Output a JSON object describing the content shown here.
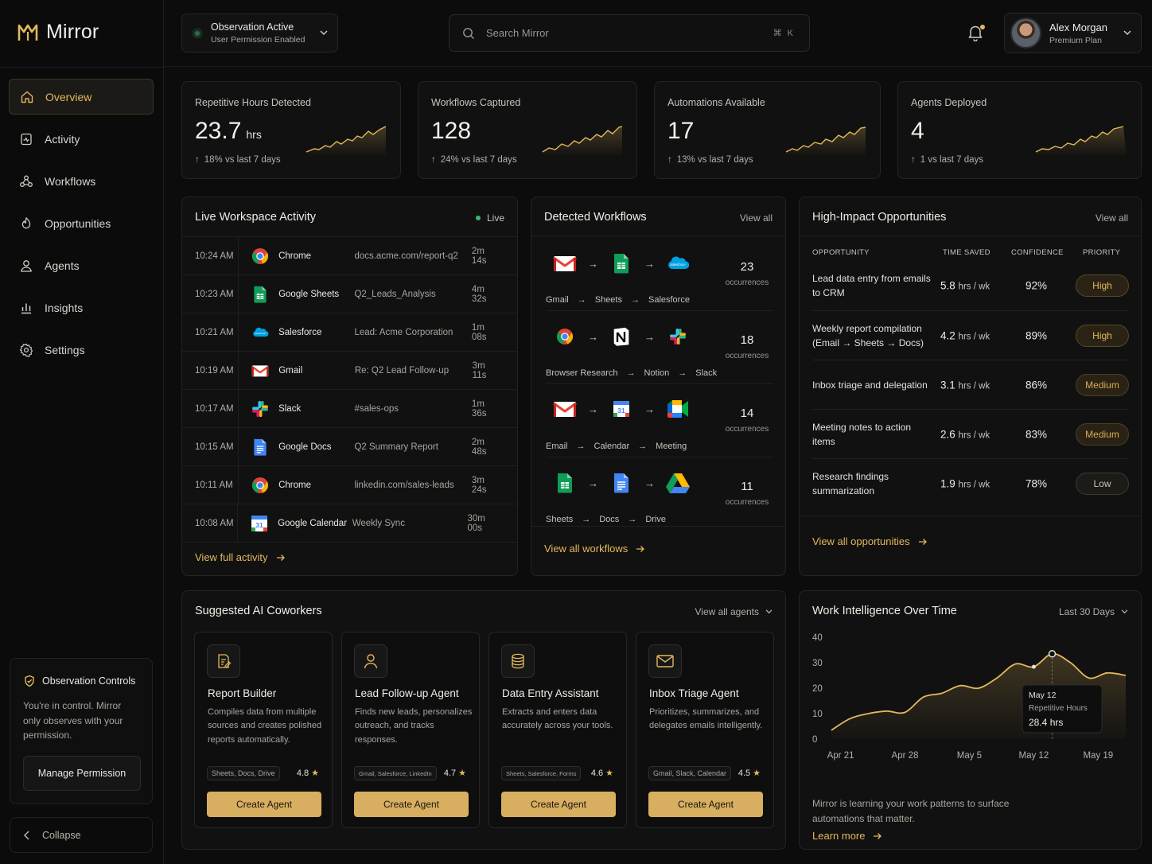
{
  "app": {
    "name": "Mirror"
  },
  "sidebar": {
    "items": [
      {
        "label": "Overview",
        "icon": "home-icon",
        "active": true
      },
      {
        "label": "Activity",
        "icon": "activity-icon",
        "active": false
      },
      {
        "label": "Workflows",
        "icon": "workflows-icon",
        "active": false
      },
      {
        "label": "Opportunities",
        "icon": "opportunities-icon",
        "active": false
      },
      {
        "label": "Agents",
        "icon": "agents-icon",
        "active": false
      },
      {
        "label": "Insights",
        "icon": "insights-icon",
        "active": false
      },
      {
        "label": "Settings",
        "icon": "settings-icon",
        "active": false
      }
    ],
    "observation": {
      "title": "Observation Controls",
      "text": "You're in control. Mirror only observes with your permission.",
      "button": "Manage Permission"
    },
    "collapse_label": "Collapse"
  },
  "topbar": {
    "status_title": "Observation Active",
    "status_subtitle": "User Permission Enabled",
    "search_placeholder": "Search Mirror",
    "search_shortcut": "⌘ K",
    "user_name": "Alex Morgan",
    "user_plan": "Premium Plan"
  },
  "stats": [
    {
      "label": "Repetitive Hours Detected",
      "value": "23.7",
      "unit": "hrs",
      "delta": "18% vs last 7 days"
    },
    {
      "label": "Workflows Captured",
      "value": "128",
      "unit": "",
      "delta": "24% vs last 7 days"
    },
    {
      "label": "Automations Available",
      "value": "17",
      "unit": "",
      "delta": "13% vs last 7 days"
    },
    {
      "label": "Agents Deployed",
      "value": "4",
      "unit": "",
      "delta": "1 vs last 7 days"
    }
  ],
  "activity": {
    "title": "Live Workspace Activity",
    "live_label": "Live",
    "rows": [
      {
        "time": "10:24 AM",
        "app": "Chrome",
        "detail": "docs.acme.com/report-q2",
        "duration": "2m 14s",
        "icon": "chrome-icon"
      },
      {
        "time": "10:23 AM",
        "app": "Google Sheets",
        "detail": "Q2_Leads_Analysis",
        "duration": "4m 32s",
        "icon": "sheets-icon"
      },
      {
        "time": "10:21 AM",
        "app": "Salesforce",
        "detail": "Lead: Acme Corporation",
        "duration": "1m 08s",
        "icon": "salesforce-icon"
      },
      {
        "time": "10:19 AM",
        "app": "Gmail",
        "detail": "Re: Q2 Lead Follow-up",
        "duration": "3m 11s",
        "icon": "gmail-icon"
      },
      {
        "time": "10:17 AM",
        "app": "Slack",
        "detail": "#sales-ops",
        "duration": "1m 36s",
        "icon": "slack-icon"
      },
      {
        "time": "10:15 AM",
        "app": "Google Docs",
        "detail": "Q2 Summary Report",
        "duration": "2m 48s",
        "icon": "docs-icon"
      },
      {
        "time": "10:11 AM",
        "app": "Chrome",
        "detail": "linkedin.com/sales-leads",
        "duration": "3m 24s",
        "icon": "chrome-icon"
      },
      {
        "time": "10:08 AM",
        "app": "Google Calendar",
        "detail": "Weekly Sync",
        "duration": "30m 00s",
        "icon": "calendar-icon"
      }
    ],
    "footer_link": "View full activity"
  },
  "workflows": {
    "title": "Detected Workflows",
    "view_all": "View all",
    "rows": [
      {
        "apps": [
          "Gmail",
          "Sheets",
          "Salesforce"
        ],
        "icons": [
          "gmail-icon",
          "sheets-icon",
          "salesforce-icon"
        ],
        "count": "23",
        "unit": "occurrences"
      },
      {
        "apps": [
          "Browser Research",
          "Notion",
          "Slack"
        ],
        "icons": [
          "chrome-icon",
          "notion-icon",
          "slack-icon"
        ],
        "count": "18",
        "unit": "occurrences"
      },
      {
        "apps": [
          "Email",
          "Calendar",
          "Meeting"
        ],
        "icons": [
          "gmail-icon",
          "calendar-icon",
          "meet-icon"
        ],
        "count": "14",
        "unit": "occurrences"
      },
      {
        "apps": [
          "Sheets",
          "Docs",
          "Drive"
        ],
        "icons": [
          "sheets-icon",
          "docs-icon",
          "drive-icon"
        ],
        "count": "11",
        "unit": "occurrences"
      }
    ],
    "footer_link": "View all workflows"
  },
  "opportunities": {
    "title": "High-Impact Opportunities",
    "view_all": "View all",
    "headers": {
      "opportunity": "OPPORTUNITY",
      "time_saved": "TIME SAVED",
      "confidence": "CONFIDENCE",
      "priority": "PRIORITY"
    },
    "rows": [
      {
        "name": "Lead data entry from emails to CRM",
        "hours": "5.8",
        "unit": "hrs / wk",
        "confidence": "92%",
        "priority": "High",
        "level": "high"
      },
      {
        "name": "Weekly report compilation (Email → Sheets → Docs)",
        "hours": "4.2",
        "unit": "hrs / wk",
        "confidence": "89%",
        "priority": "High",
        "level": "high"
      },
      {
        "name": "Inbox triage and delegation",
        "hours": "3.1",
        "unit": "hrs / wk",
        "confidence": "86%",
        "priority": "Medium",
        "level": "medium"
      },
      {
        "name": "Meeting notes to action items",
        "hours": "2.6",
        "unit": "hrs / wk",
        "confidence": "83%",
        "priority": "Medium",
        "level": "medium"
      },
      {
        "name": "Research findings summarization",
        "hours": "1.9",
        "unit": "hrs / wk",
        "confidence": "78%",
        "priority": "Low",
        "level": "low"
      }
    ],
    "footer_link": "View all opportunities"
  },
  "agents": {
    "title": "Suggested AI Coworkers",
    "view_all": "View all agents",
    "cards": [
      {
        "name": "Report Builder",
        "desc": "Compiles data from multiple sources and creates polished reports automatically.",
        "tags": "Sheets, Docs, Drive",
        "rating": "4.8",
        "button": "Create Agent",
        "icon": "report-icon"
      },
      {
        "name": "Lead Follow-up Agent",
        "desc": "Finds new leads, personalizes outreach, and tracks responses.",
        "tags": "Gmail, Salesforce, LinkedIn",
        "rating": "4.7",
        "button": "Create Agent",
        "icon": "user-icon"
      },
      {
        "name": "Data Entry Assistant",
        "desc": "Extracts and enters data accurately across your tools.",
        "tags": "Sheets, Salesforce, Forms",
        "rating": "4.6",
        "button": "Create Agent",
        "icon": "database-icon"
      },
      {
        "name": "Inbox Triage Agent",
        "desc": "Prioritizes, summarizes, and delegates emails intelligently.",
        "tags": "Gmail, Slack, Calendar",
        "rating": "4.5",
        "button": "Create Agent",
        "icon": "mail-icon"
      }
    ]
  },
  "intelligence": {
    "title": "Work Intelligence Over Time",
    "range_label": "Last 30 Days",
    "tooltip": {
      "date": "May 12",
      "label": "Repetitive Hours",
      "value": "28.4 hrs"
    },
    "footer_text": "Mirror is learning your work patterns to surface automations that matter.",
    "footer_link": "Learn more"
  },
  "colors": {
    "accent": "#e4b85c",
    "background": "#0c0c0c",
    "card": "#111111",
    "live": "#3fb56d"
  },
  "chart_data": {
    "type": "area",
    "title": "Work Intelligence Over Time",
    "xlabel": "",
    "ylabel": "",
    "ylim": [
      0,
      40
    ],
    "yticks": [
      "0",
      "10",
      "20",
      "30",
      "40"
    ],
    "xticks": [
      "Apr 21",
      "Apr 28",
      "May 5",
      "May 12",
      "May 19"
    ],
    "x": [
      "Apr 20",
      "Apr 22",
      "Apr 24",
      "Apr 26",
      "Apr 28",
      "Apr 30",
      "May 2",
      "May 4",
      "May 6",
      "May 8",
      "May 10",
      "May 12",
      "May 14",
      "May 16",
      "May 18",
      "May 20",
      "May 22"
    ],
    "series": [
      {
        "values": [
          3.5,
          8,
          10,
          11,
          10.5,
          16.5,
          18,
          21,
          20,
          24,
          29.5,
          28.4,
          33.5,
          30,
          24,
          26,
          25
        ]
      }
    ],
    "highlight": {
      "x": "May 12",
      "value": 28.4
    },
    "peak": {
      "x": "May 14",
      "value": 33.5
    },
    "grid": true
  }
}
